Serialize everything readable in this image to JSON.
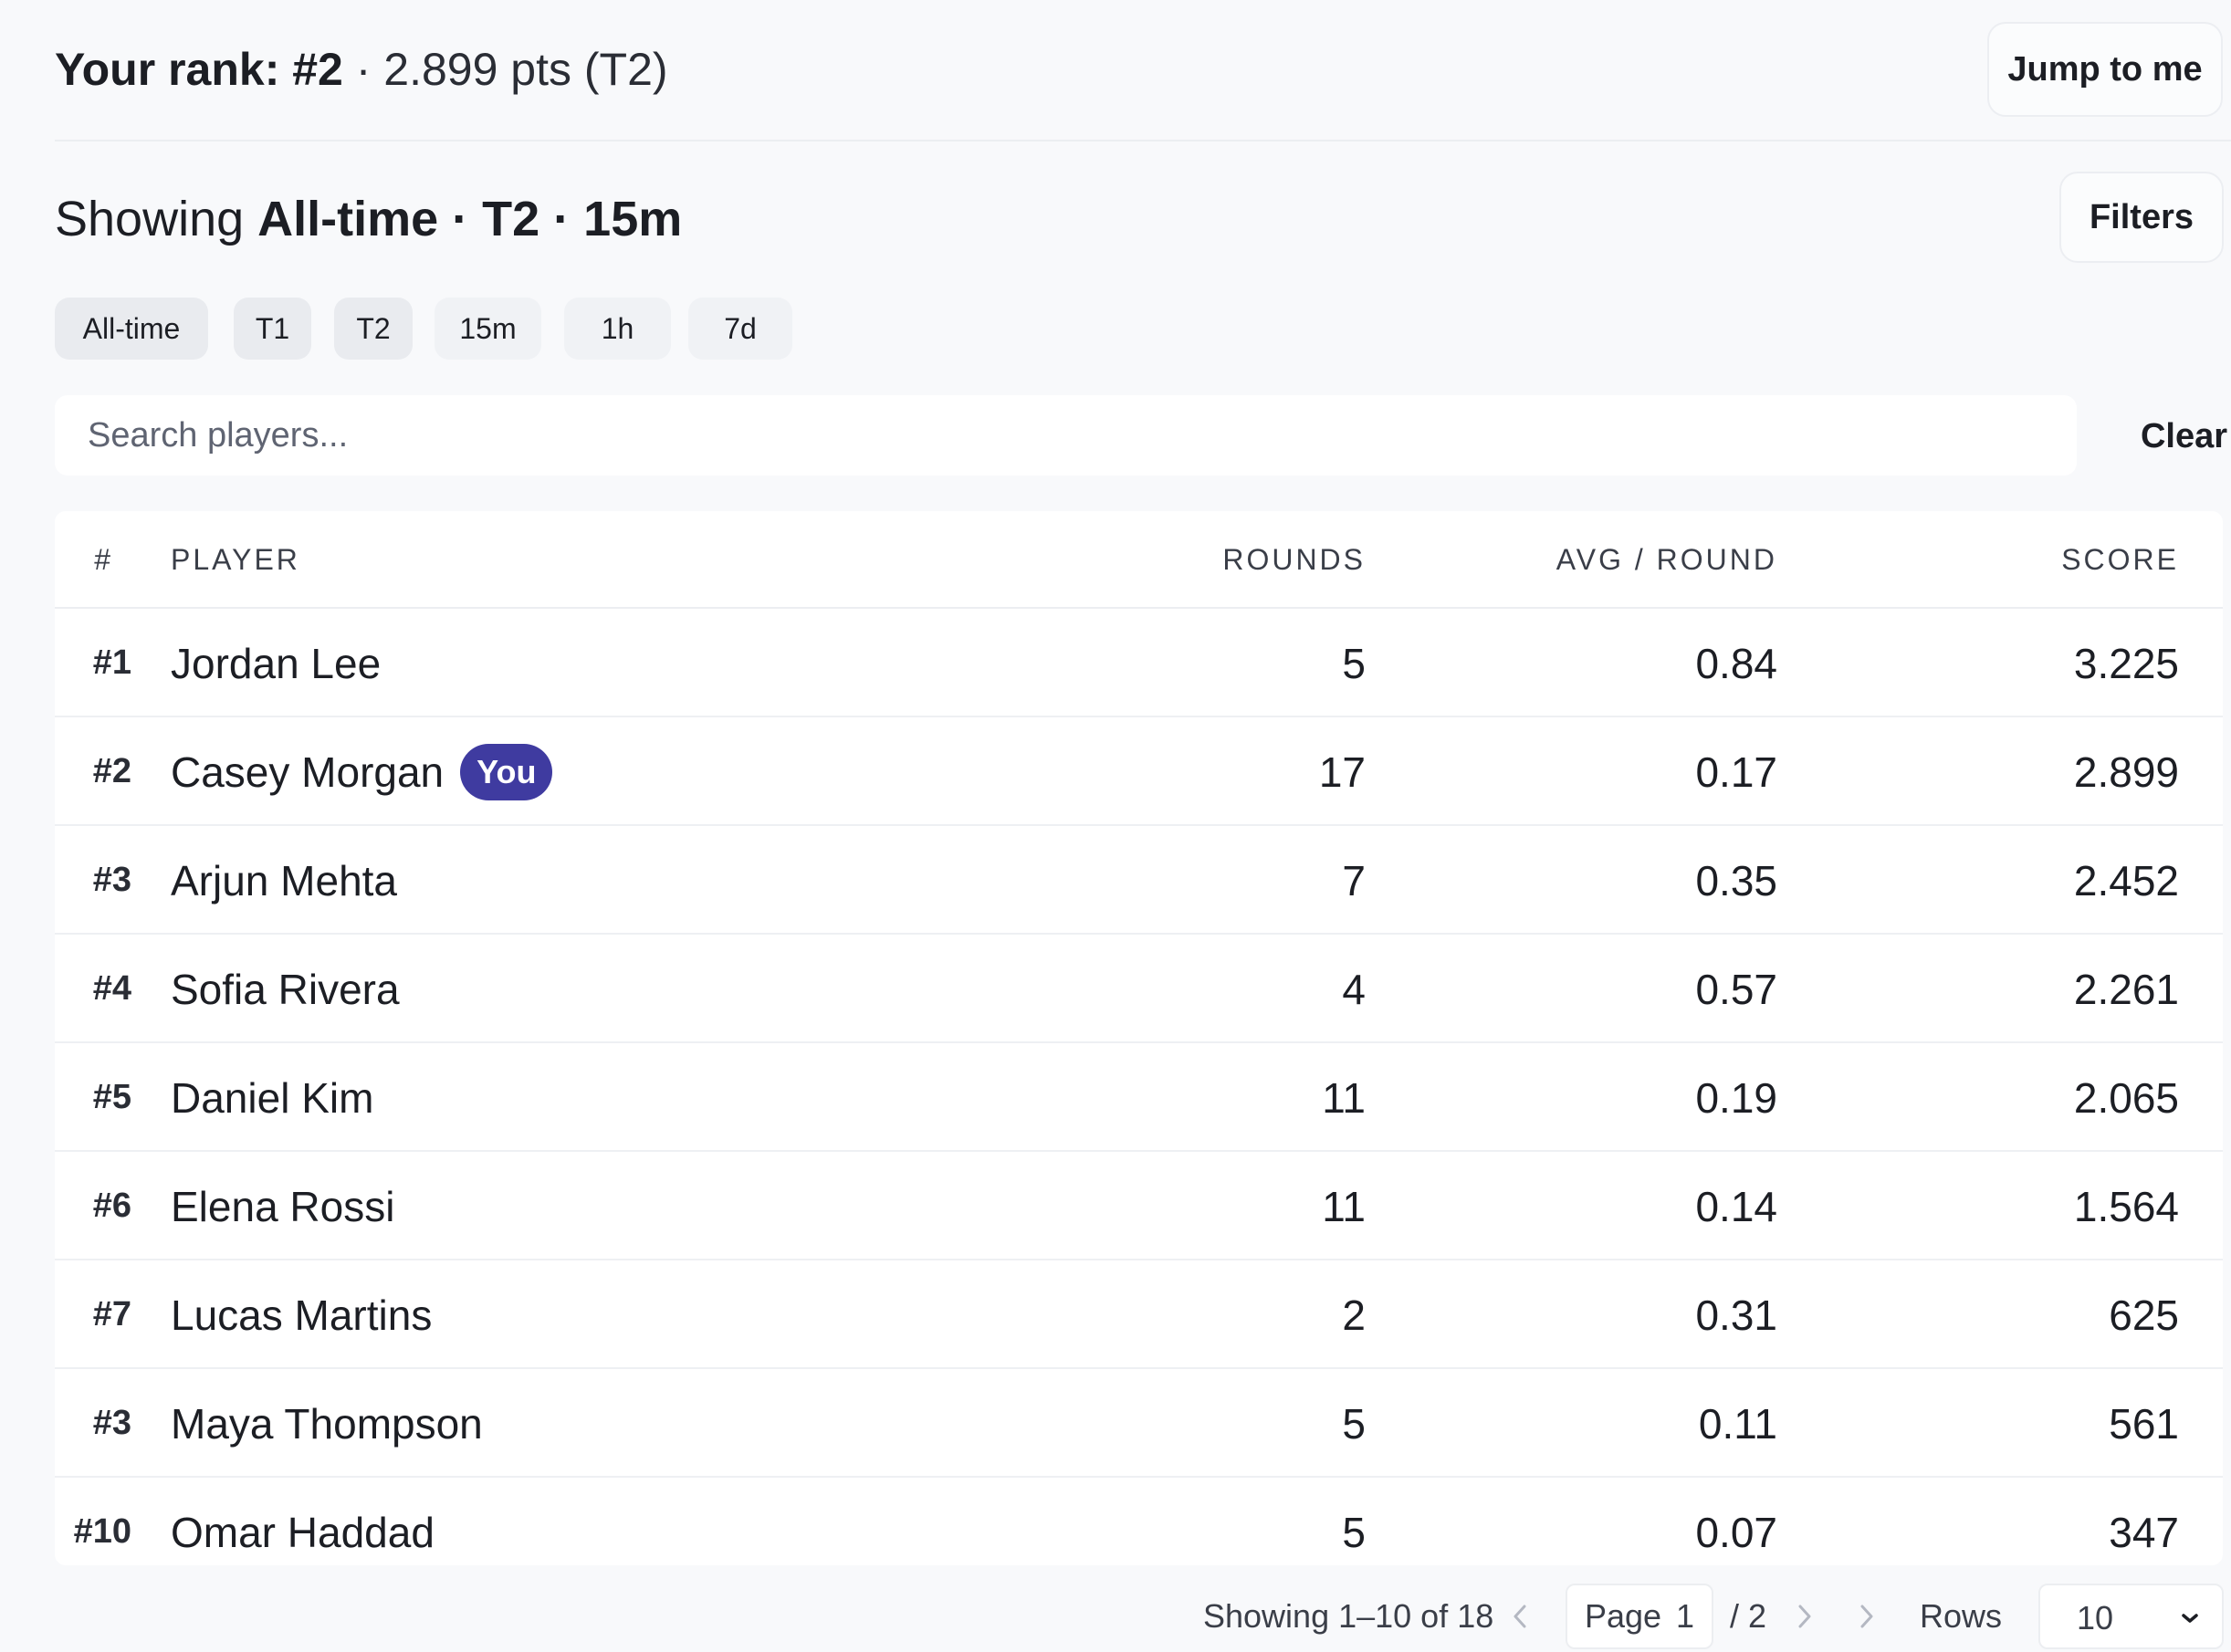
{
  "header": {
    "rank_label": "Your rank: #2",
    "rank_detail": " · 2.899 pts (T2)",
    "jump_button": "Jump to me"
  },
  "showing": {
    "prefix": "Showing ",
    "filter_summary": "All-time · T2 · 15m",
    "filters_button": "Filters"
  },
  "chips": [
    {
      "label": "All-time",
      "active": true
    },
    {
      "label": "T1",
      "active": true
    },
    {
      "label": "T2",
      "active": true
    },
    {
      "label": "15m",
      "active": false
    },
    {
      "label": "1h",
      "active": false
    },
    {
      "label": "7d",
      "active": false
    }
  ],
  "search": {
    "placeholder": "Search players...",
    "clear_label": "Clear"
  },
  "table": {
    "columns": [
      "#",
      "PLAYER",
      "ROUNDS",
      "AVG / ROUND",
      "SCORE"
    ],
    "rows": [
      {
        "rank": "#1",
        "player": "Jordan Lee",
        "rounds": "5",
        "avg": "0.84",
        "score": "3.225"
      },
      {
        "rank": "#2",
        "player": "Casey Morgan",
        "badge": "You",
        "rounds": "17",
        "avg": "0.17",
        "score": "2.899"
      },
      {
        "rank": "#3",
        "player": "Arjun Mehta",
        "rounds": "7",
        "avg": "0.35",
        "score": "2.452"
      },
      {
        "rank": "#4",
        "player": "Sofia Rivera",
        "rounds": "4",
        "avg": "0.57",
        "score": "2.261"
      },
      {
        "rank": "#5",
        "player": "Daniel Kim",
        "rounds": "11",
        "avg": "0.19",
        "score": "2.065"
      },
      {
        "rank": "#6",
        "player": "Elena Rossi",
        "rounds": "11",
        "avg": "0.14",
        "score": "1.564"
      },
      {
        "rank": "#7",
        "player": "Lucas Martins",
        "rounds": "2",
        "avg": "0.31",
        "score": "625"
      },
      {
        "rank": "#3",
        "player": "Maya Thompson",
        "rounds": "5",
        "avg": "0.11",
        "score": "561"
      },
      {
        "rank": "#10",
        "player": "Omar Haddad",
        "rounds": "5",
        "avg": "0.07",
        "score": "347"
      }
    ]
  },
  "pagination": {
    "showing_text": "Showing 1–10 of 18",
    "page_label": "Page",
    "page_value": "1",
    "page_total": "/ 2",
    "rows_label": "Rows",
    "rows_value": "10"
  },
  "icons": {
    "prev": "chevron-left-icon",
    "next": "chevron-right-icon",
    "last": "chevron-right-icon",
    "dropdown": "chevron-down-icon"
  },
  "colors": {
    "you_badge": "#3f3ba0",
    "background": "#f8f9fb"
  }
}
